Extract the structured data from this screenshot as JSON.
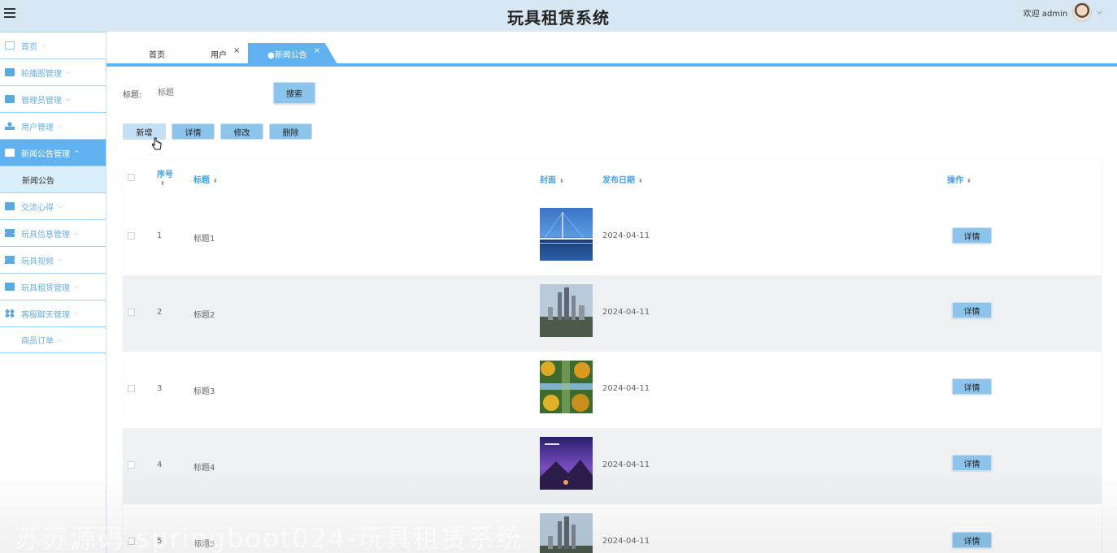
{
  "header": {
    "title": "玩具租赁系统",
    "welcome": "欢迎 admin"
  },
  "sidebar": {
    "items": [
      {
        "label": "首页",
        "icon": "home-icon"
      },
      {
        "label": "轮播图管理",
        "icon": "image-icon"
      },
      {
        "label": "管理员管理",
        "icon": "table-icon"
      },
      {
        "label": "用户管理",
        "icon": "user-icon"
      },
      {
        "label": "新闻公告管理",
        "icon": "news-icon",
        "active": true,
        "sub": "新闻公告"
      },
      {
        "label": "交流心得",
        "icon": "briefcase-icon"
      },
      {
        "label": "玩具信息管理",
        "icon": "grid-icon"
      },
      {
        "label": "玩具视频",
        "icon": "grid-icon"
      },
      {
        "label": "玩具租赁管理",
        "icon": "briefcase-icon"
      },
      {
        "label": "客服聊天管理",
        "icon": "apps-icon"
      },
      {
        "label": "商品订单",
        "icon": ""
      }
    ]
  },
  "tabs": [
    {
      "label": "首页"
    },
    {
      "label": "用户",
      "close": "×"
    },
    {
      "label": "●新闻公告",
      "close": "×",
      "active": true
    }
  ],
  "search": {
    "label": "标题:",
    "placeholder": "标题",
    "button": "搜索"
  },
  "actions": {
    "add": "新增",
    "detail": "详情",
    "edit": "修改",
    "delete": "删除"
  },
  "table": {
    "columns": {
      "index": "序号",
      "title": "标题",
      "cover": "封面",
      "date": "发布日期",
      "ops": "操作"
    },
    "rows": [
      {
        "index": "1",
        "title": "标题1",
        "date": "2024-04-11",
        "op": "详情",
        "cover": "bridge-photo"
      },
      {
        "index": "2",
        "title": "标题2",
        "date": "2024-04-11",
        "op": "详情",
        "cover": "city-towers-photo"
      },
      {
        "index": "3",
        "title": "标题3",
        "date": "2024-04-11",
        "op": "详情",
        "cover": "autumn-road-photo"
      },
      {
        "index": "4",
        "title": "标题4",
        "date": "2024-04-11",
        "op": "详情",
        "cover": "purple-poster-photo"
      },
      {
        "index": "5",
        "title": "标题5",
        "date": "2024-04-11",
        "op": "详情",
        "cover": "city-towers-photo"
      }
    ]
  },
  "watermark": "苏苏源码-springboot024-玩具租赁系统",
  "colors": {
    "accent": "#5fb2ef",
    "button": "#8dc4ec",
    "header_bg": "#d7e7f3",
    "stripe": "#eef1f3"
  }
}
